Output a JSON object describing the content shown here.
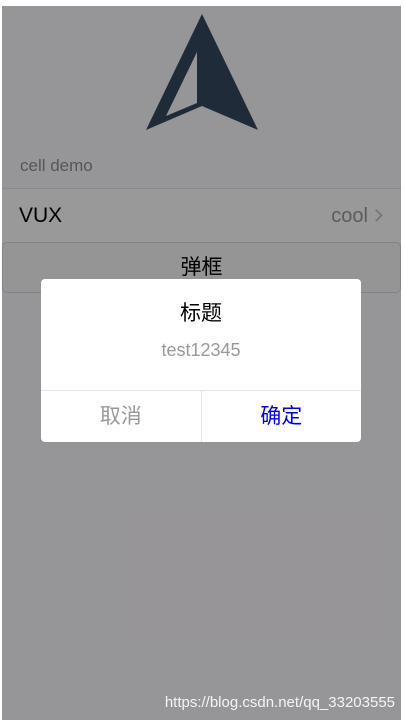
{
  "list": {
    "group_title": "cell demo",
    "cell": {
      "title": "VUX",
      "value": "cool",
      "icon": "chevron-right-icon"
    }
  },
  "open_button_label": "弹框",
  "dialog": {
    "title": "标题",
    "content": "test12345",
    "cancel_label": "取消",
    "confirm_label": "确定",
    "confirm_color": "#0000ee"
  },
  "watermark": "https://blog.csdn.net/qq_33203555",
  "logo": {
    "icon": "navigation-arrow-logo",
    "color": "#35495e"
  }
}
